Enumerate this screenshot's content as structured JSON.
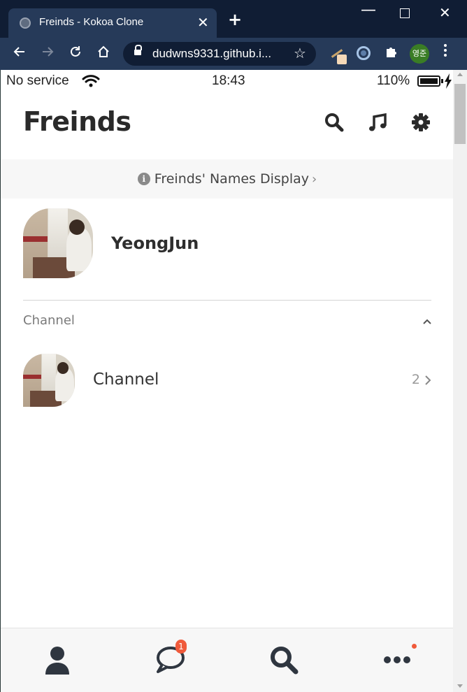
{
  "browser": {
    "tab_title": "Freinds - Kokoa Clone",
    "tab_close": "✕",
    "new_tab": "+",
    "url": "dudwns9331.github.i...",
    "profile_initials": "영준",
    "window_min": "—",
    "window_close": "✕"
  },
  "status_bar": {
    "carrier": "No service",
    "time": "18:43",
    "battery_pct": "110%"
  },
  "header": {
    "title": "Freinds"
  },
  "banner": {
    "info_glyph": "i",
    "text": "Freinds' Names Display",
    "chevron": "›"
  },
  "profile": {
    "name": "YeongJun"
  },
  "channel_section": {
    "title": "Channel"
  },
  "channel": {
    "name": "Channel",
    "count": "2"
  },
  "tabs": {
    "chats_badge": "1"
  },
  "colors": {
    "chrome_dark": "#101d34",
    "chrome_toolbar": "#263a59",
    "badge": "#f05a3b",
    "text_dark": "#2a2a2a"
  },
  "icons": [
    "search-icon",
    "music-icon",
    "gear-icon",
    "info-icon",
    "person-icon",
    "chat-bubble-icon",
    "magnifier-icon",
    "ellipsis-icon",
    "wifi-icon",
    "battery-icon",
    "bolt-icon"
  ]
}
